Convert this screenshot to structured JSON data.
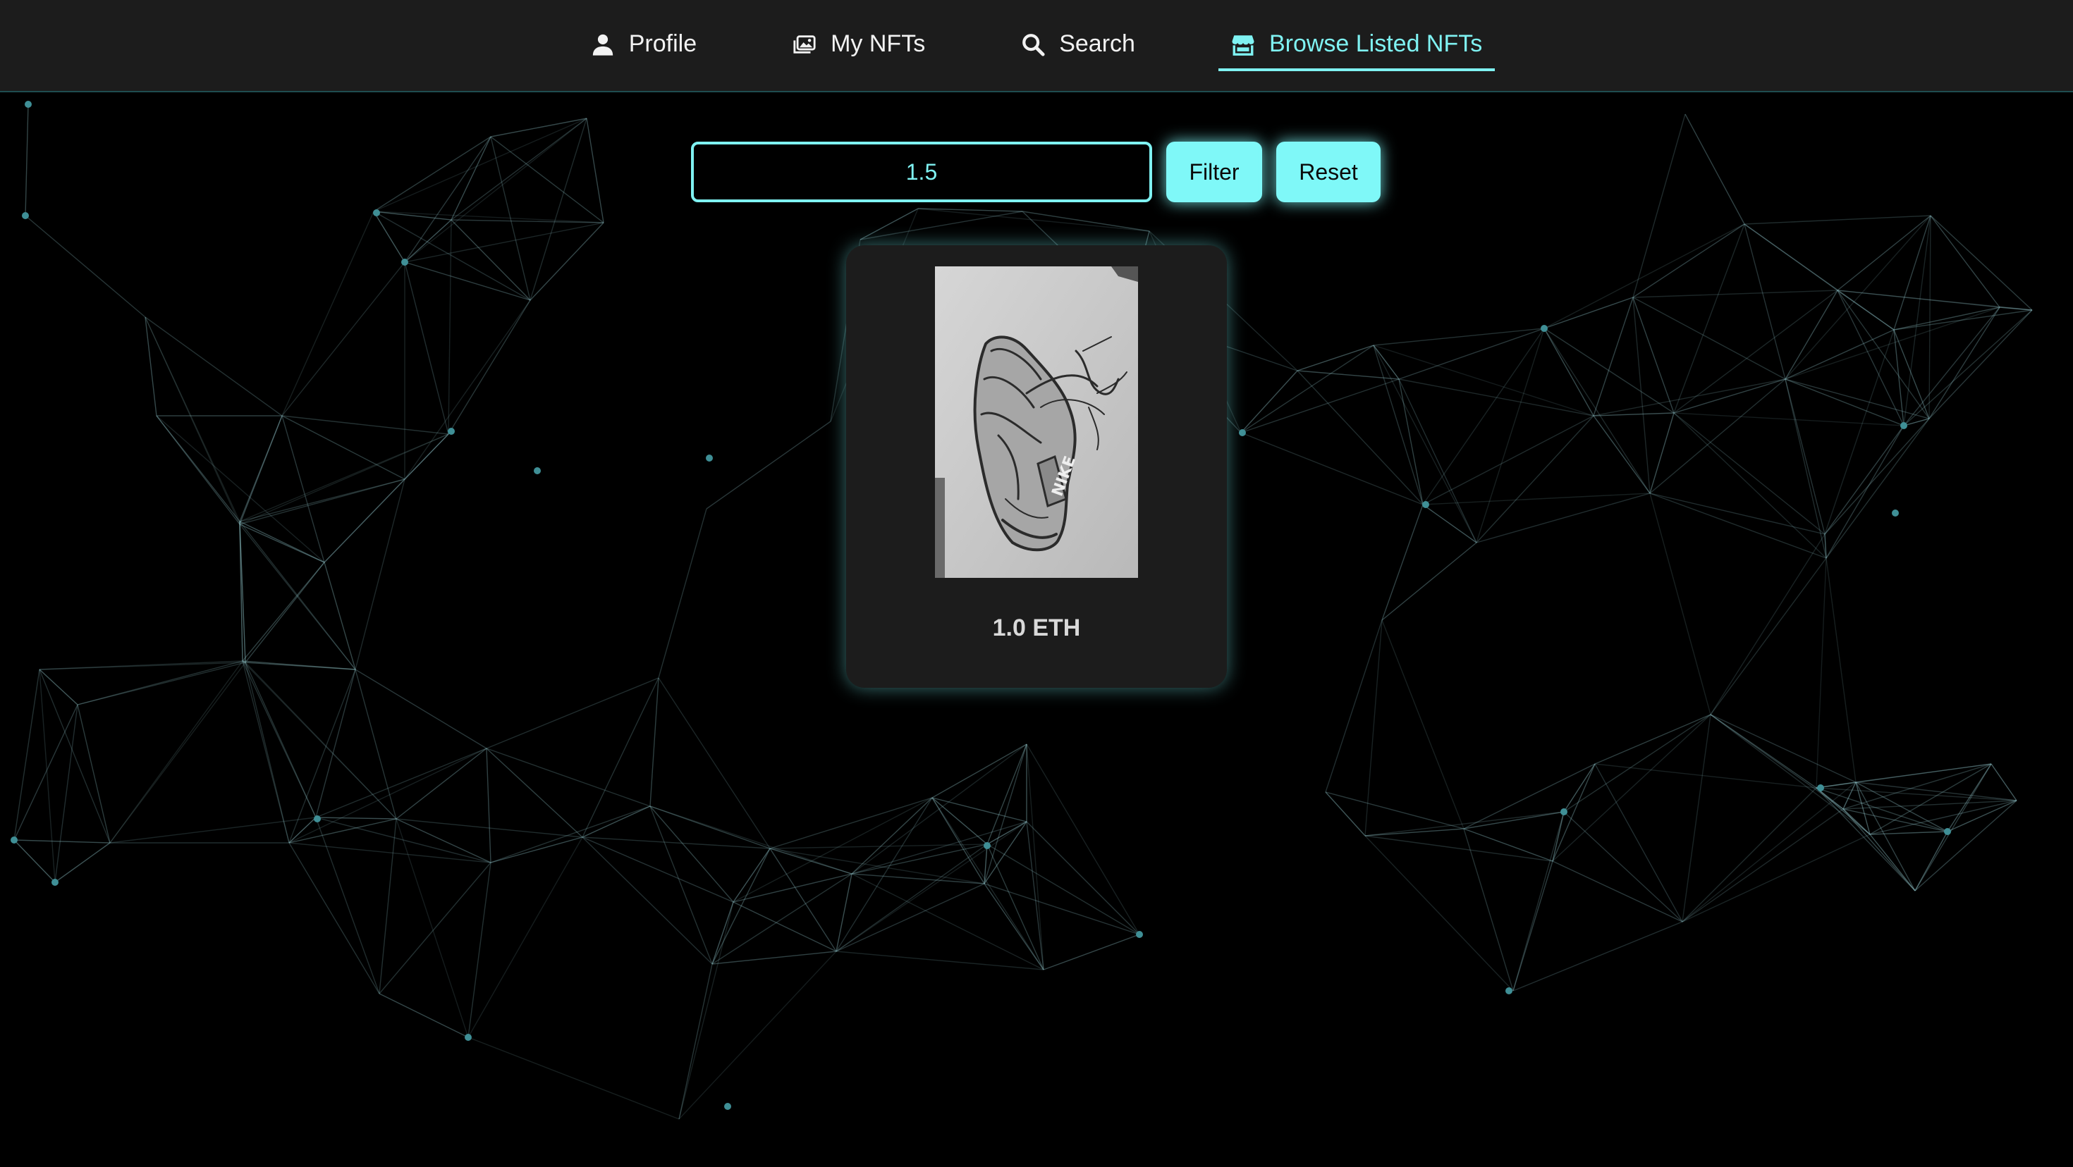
{
  "nav": {
    "items": [
      {
        "label": "Profile",
        "icon": "user-icon",
        "active": false
      },
      {
        "label": "My NFTs",
        "icon": "images-icon",
        "active": false
      },
      {
        "label": "Search",
        "icon": "search-icon",
        "active": false
      },
      {
        "label": "Browse Listed NFTs",
        "icon": "store-icon",
        "active": true
      }
    ]
  },
  "filter": {
    "input_value": "1.5",
    "filter_label": "Filter",
    "reset_label": "Reset"
  },
  "listings": [
    {
      "price": "1.0 ETH",
      "image": "pencil sketch of a sneaker"
    }
  ],
  "colors": {
    "accent": "#7ff2f2",
    "background": "#000000",
    "navbar": "#1c1c1c",
    "card": "#1c1c1c"
  }
}
